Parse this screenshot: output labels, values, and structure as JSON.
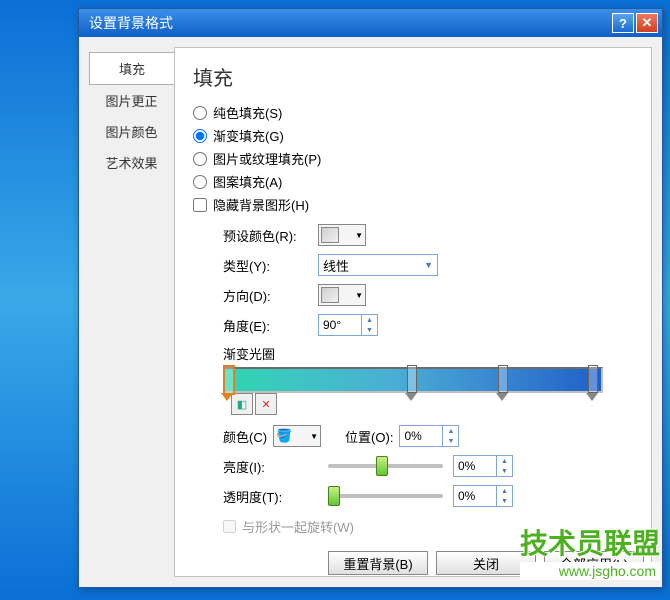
{
  "titlebar": {
    "title": "设置背景格式"
  },
  "sidebar": {
    "items": [
      {
        "label": "填充"
      },
      {
        "label": "图片更正"
      },
      {
        "label": "图片颜色"
      },
      {
        "label": "艺术效果"
      }
    ]
  },
  "panel": {
    "title": "填充",
    "radios": {
      "solid": "纯色填充(S)",
      "gradient": "渐变填充(G)",
      "picture": "图片或纹理填充(P)",
      "pattern": "图案填充(A)"
    },
    "hide_bg": "隐藏背景图形(H)",
    "preset_label": "预设颜色(R):",
    "type_label": "类型(Y):",
    "type_value": "线性",
    "direction_label": "方向(D):",
    "angle_label": "角度(E):",
    "angle_value": "90°",
    "stops_label": "渐变光圈",
    "color_label": "颜色(C)",
    "position_label": "位置(O):",
    "position_value": "0%",
    "brightness_label": "亮度(I):",
    "brightness_value": "0%",
    "transparency_label": "透明度(T):",
    "transparency_value": "0%",
    "rotate_label": "与形状一起旋转(W)"
  },
  "footer": {
    "reset": "重置背景(B)",
    "close": "关闭",
    "apply_all": "全部应用(L)"
  },
  "watermark": {
    "line1": "技术员联盟",
    "line2": "www.jsgho.com"
  }
}
